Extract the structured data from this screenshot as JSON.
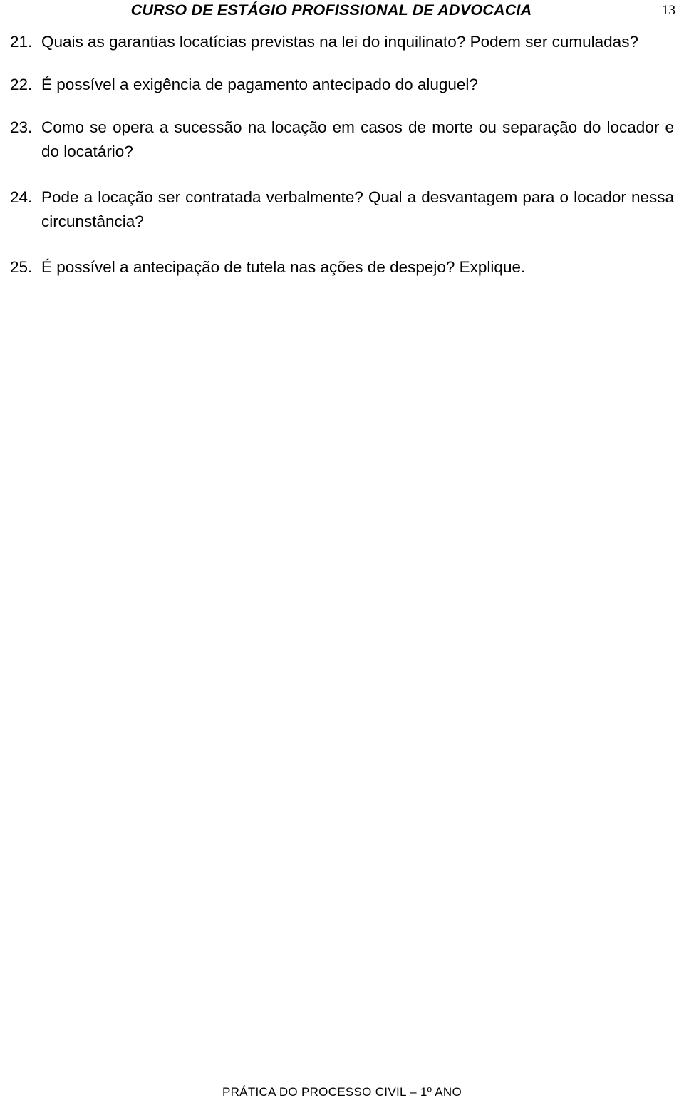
{
  "header": {
    "title": "CURSO DE ESTÁGIO PROFISSIONAL DE ADVOCACIA",
    "page_number": "13"
  },
  "questions": [
    {
      "number": "21.",
      "text": "Quais as garantias locatícias previstas na lei do inquilinato?  Podem ser cumuladas?"
    },
    {
      "number": "22.",
      "text": "É possível a exigência de pagamento antecipado do aluguel?"
    },
    {
      "number": "23.",
      "text": "Como se opera a sucessão na locação em casos de morte ou separação do locador e do locatário?"
    },
    {
      "number": "24.",
      "text": "Pode a locação ser contratada verbalmente?  Qual a desvantagem para o locador nessa circunstância?"
    },
    {
      "number": "25.",
      "text": "É possível a antecipação de tutela nas ações de despejo? Explique."
    }
  ],
  "footer": {
    "text": "PRÁTICA DO PROCESSO CIVIL – 1º ANO"
  }
}
